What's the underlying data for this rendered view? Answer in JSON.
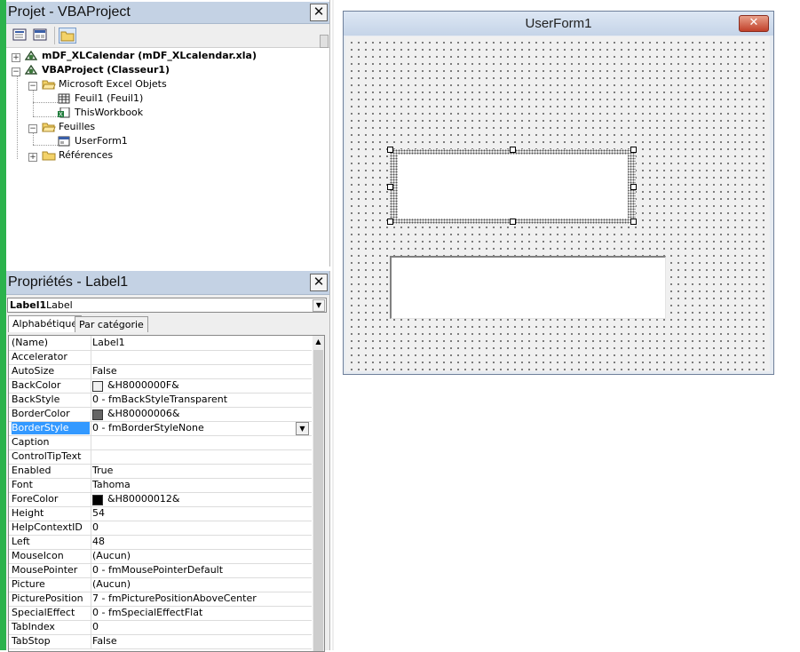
{
  "project_panel": {
    "title": "Projet - VBAProject",
    "tree": [
      {
        "label": "mDF_XLCalendar (mDF_XLcalendar.xla)"
      },
      {
        "label": "VBAProject (Classeur1)"
      },
      {
        "label": "Microsoft Excel Objets"
      },
      {
        "label": "Feuil1 (Feuil1)"
      },
      {
        "label": "ThisWorkbook"
      },
      {
        "label": "Feuilles"
      },
      {
        "label": "UserForm1"
      },
      {
        "label": "Références"
      }
    ]
  },
  "properties_panel": {
    "title": "Propriétés - Label1",
    "object_name": "Label1",
    "object_type": "Label",
    "tabs": [
      {
        "label": "Alphabétique"
      },
      {
        "label": "Par catégorie"
      }
    ],
    "properties": [
      {
        "name": "(Name)",
        "value": "Label1"
      },
      {
        "name": "Accelerator",
        "value": ""
      },
      {
        "name": "AutoSize",
        "value": "False"
      },
      {
        "name": "BackColor",
        "value": "&H8000000F&",
        "swatch": "#f0f0f0"
      },
      {
        "name": "BackStyle",
        "value": "0 - fmBackStyleTransparent"
      },
      {
        "name": "BorderColor",
        "value": "&H80000006&",
        "swatch": "#646464"
      },
      {
        "name": "BorderStyle",
        "value": "0 - fmBorderStyleNone"
      },
      {
        "name": "Caption",
        "value": ""
      },
      {
        "name": "ControlTipText",
        "value": ""
      },
      {
        "name": "Enabled",
        "value": "True"
      },
      {
        "name": "Font",
        "value": "Tahoma"
      },
      {
        "name": "ForeColor",
        "value": "&H80000012&",
        "swatch": "#000000"
      },
      {
        "name": "Height",
        "value": "54"
      },
      {
        "name": "HelpContextID",
        "value": "0"
      },
      {
        "name": "Left",
        "value": "48"
      },
      {
        "name": "MouseIcon",
        "value": "(Aucun)"
      },
      {
        "name": "MousePointer",
        "value": "0 - fmMousePointerDefault"
      },
      {
        "name": "Picture",
        "value": "(Aucun)"
      },
      {
        "name": "PicturePosition",
        "value": "7 - fmPicturePositionAboveCenter"
      },
      {
        "name": "SpecialEffect",
        "value": "0 - fmSpecialEffectFlat"
      },
      {
        "name": "TabIndex",
        "value": "0"
      },
      {
        "name": "TabStop",
        "value": "False"
      }
    ]
  },
  "userform": {
    "title": "UserForm1",
    "close_glyph": "✕"
  },
  "colors": {
    "selection": "#3399ff",
    "titlebar": "#c4d2e4"
  }
}
